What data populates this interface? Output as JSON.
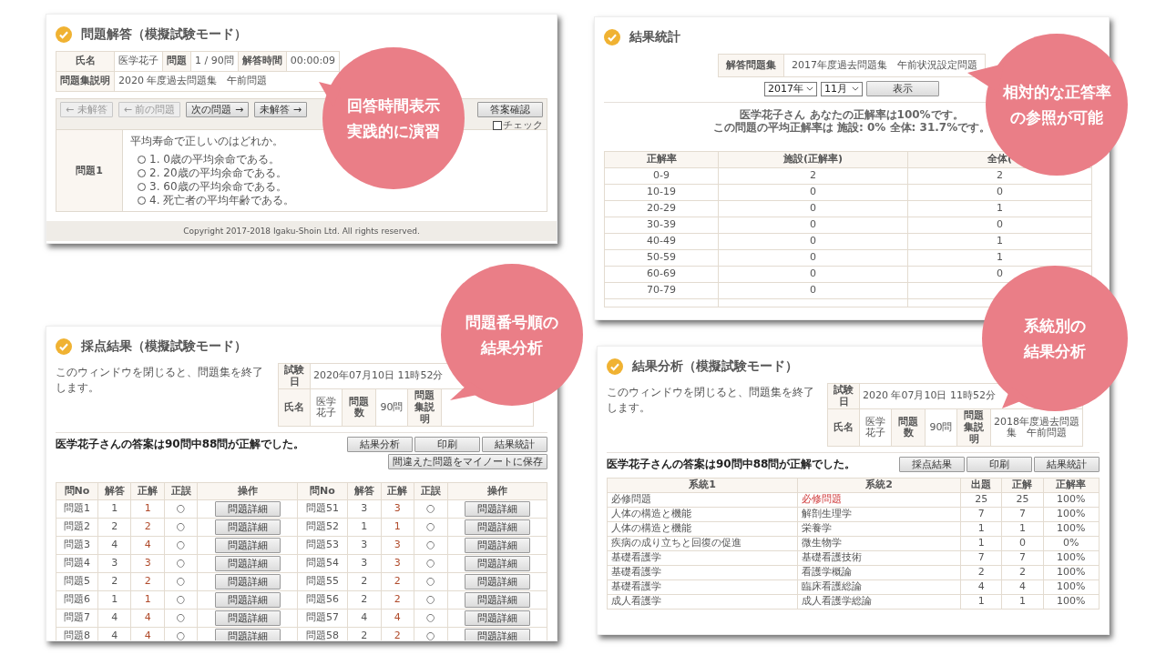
{
  "answer_panel": {
    "title": "問題解答（模擬試験モード）",
    "info": [
      {
        "label": "氏名",
        "value": "医学花子"
      },
      {
        "label": "問題",
        "value": "1 / 90問"
      },
      {
        "label": "解答時間",
        "value": "00:00:09"
      }
    ],
    "description": {
      "label": "問題集説明",
      "value": "2020 年度過去問題集　午前問題"
    },
    "nav_buttons": [
      {
        "label": "← 未解答",
        "disabled": true
      },
      {
        "label": "← 前の問題",
        "disabled": true
      },
      {
        "label": "次の問題 →",
        "disabled": false
      },
      {
        "label": "未解答 →",
        "disabled": false
      }
    ],
    "confirm_button": "答案確認",
    "check": {
      "label": "チェック",
      "checked": false
    },
    "question": {
      "label": "問題1",
      "text": "平均寿命で正しいのはどれか。",
      "options": [
        {
          "label": "1. 0歳の平均余命である。",
          "selected": false
        },
        {
          "label": "2. 20歳の平均余命である。",
          "selected": false
        },
        {
          "label": "3. 60歳の平均余命である。",
          "selected": false
        },
        {
          "label": "4. 死亡者の平均年齢である。",
          "selected": false
        }
      ]
    },
    "copyright": "Copyright 2017-2018 Igaku-Shoin Ltd. All rights reserved."
  },
  "stats_panel": {
    "title": "結果統計",
    "set": {
      "label": "解答問題集",
      "value": "2017年度過去問題集　午前状況設定問題"
    },
    "year_select": "2017年",
    "month_select": "11月",
    "show_button": "表示",
    "message": [
      "医学花子さん あなたの正解率は100%です。",
      "この問題の平均正解率は 施設: 0% 全体: 31.7%です。"
    ],
    "table": {
      "columns": [
        "正解率",
        "施設(正解率)",
        "全体("
      ],
      "rows": [
        {
          "cells": [
            "0-9",
            "2",
            "2"
          ]
        },
        {
          "cells": [
            "10-19",
            "0",
            "0"
          ]
        },
        {
          "cells": [
            "20-29",
            "0",
            "1"
          ]
        },
        {
          "cells": [
            "30-39",
            "0",
            "0"
          ]
        },
        {
          "cells": [
            "40-49",
            "0",
            "1"
          ]
        },
        {
          "cells": [
            "50-59",
            "0",
            "1"
          ]
        },
        {
          "cells": [
            "60-69",
            "0",
            "0"
          ]
        },
        {
          "cells": [
            "70-79",
            "0"
          ]
        }
      ]
    }
  },
  "scoring_panel": {
    "title": "採点結果（模擬試験モード）",
    "note": "このウィンドウを閉じると、問題集を終了します。",
    "exam_date": {
      "label": "試験日",
      "value": "2020年07月10日 11時52分"
    },
    "info": [
      {
        "label": "氏名",
        "value": "医学花子"
      },
      {
        "label": "問題数",
        "value": "90問"
      },
      {
        "label": "問題集説明"
      }
    ],
    "summary": "医学花子さんの答案は90問中88問が正解でした。",
    "buttons": [
      "結果分析",
      "印刷",
      "結果統計",
      "間違えた問題をマイノートに保存"
    ],
    "table": {
      "columns": [
        "問No",
        "解答",
        "正解",
        "正誤",
        "操作",
        "問No",
        "解答",
        "正解",
        "正誤",
        "操作"
      ],
      "rows": [
        {
          "left": {
            "no": "問題1",
            "answer": "1",
            "correct": "1",
            "mark": "○",
            "button": "問題詳細"
          },
          "right": {
            "no": "問題51",
            "answer": "3",
            "correct": "3",
            "mark": "○",
            "button": "問題詳細"
          }
        },
        {
          "left": {
            "no": "問題2",
            "answer": "2",
            "correct": "2",
            "mark": "○",
            "button": "問題詳細"
          },
          "right": {
            "no": "問題52",
            "answer": "1",
            "correct": "1",
            "mark": "○",
            "button": "問題詳細"
          }
        },
        {
          "left": {
            "no": "問題3",
            "answer": "4",
            "correct": "4",
            "mark": "○",
            "button": "問題詳細"
          },
          "right": {
            "no": "問題53",
            "answer": "3",
            "correct": "3",
            "mark": "○",
            "button": "問題詳細"
          }
        },
        {
          "left": {
            "no": "問題4",
            "answer": "3",
            "correct": "3",
            "mark": "○",
            "button": "問題詳細"
          },
          "right": {
            "no": "問題54",
            "answer": "3",
            "correct": "3",
            "mark": "○",
            "button": "問題詳細"
          }
        },
        {
          "left": {
            "no": "問題5",
            "answer": "2",
            "correct": "2",
            "mark": "○",
            "button": "問題詳細"
          },
          "right": {
            "no": "問題55",
            "answer": "2",
            "correct": "2",
            "mark": "○",
            "button": "問題詳細"
          }
        },
        {
          "left": {
            "no": "問題6",
            "answer": "1",
            "correct": "1",
            "mark": "○",
            "button": "問題詳細"
          },
          "right": {
            "no": "問題56",
            "answer": "2",
            "correct": "2",
            "mark": "○",
            "button": "問題詳細"
          }
        },
        {
          "left": {
            "no": "問題7",
            "answer": "4",
            "correct": "4",
            "mark": "○",
            "button": "問題詳細"
          },
          "right": {
            "no": "問題57",
            "answer": "4",
            "correct": "4",
            "mark": "○",
            "button": "問題詳細"
          }
        },
        {
          "left": {
            "no": "問題8",
            "answer": "4",
            "correct": "4",
            "mark": "○",
            "button": "問題詳細"
          },
          "right": {
            "no": "問題58",
            "answer": "2",
            "correct": "2",
            "mark": "○",
            "button": "問題詳細"
          }
        }
      ]
    }
  },
  "analysis_panel": {
    "title": "結果分析（模擬試験モード）",
    "note": "このウィンドウを閉じると、問題集を終了します。",
    "exam_date": {
      "label": "試験日",
      "value": "2020 年07月10日 11時52分"
    },
    "info": [
      {
        "label": "氏名",
        "value": "医学花子"
      },
      {
        "label": "問題数",
        "value": "90問"
      },
      {
        "label": "問題集説明",
        "value": "2018年度過去問題集　午前問題"
      }
    ],
    "summary": "医学花子さんの答案は90問中88問が正解でした。",
    "buttons": [
      "採点結果",
      "印刷",
      "結果統計"
    ],
    "table": {
      "columns": [
        "系統1",
        "系統2",
        "出題",
        "正解",
        "正解率"
      ],
      "rows": [
        {
          "cells": [
            "必修問題",
            "必修問題",
            "25",
            "25",
            "100%"
          ],
          "highlighted": true
        },
        {
          "cells": [
            "人体の構造と機能",
            "解剖生理学",
            "7",
            "7",
            "100%"
          ],
          "highlighted": false
        },
        {
          "cells": [
            "人体の構造と機能",
            "栄養学",
            "1",
            "1",
            "100%"
          ],
          "highlighted": false
        },
        {
          "cells": [
            "疾病の成り立ちと回復の促進",
            "微生物学",
            "1",
            "0",
            "0%"
          ],
          "highlighted": false
        },
        {
          "cells": [
            "基礎看護学",
            "基礎看護技術",
            "7",
            "7",
            "100%"
          ],
          "highlighted": false
        },
        {
          "cells": [
            "基礎看護学",
            "看護学概論",
            "2",
            "2",
            "100%"
          ],
          "highlighted": false
        },
        {
          "cells": [
            "基礎看護学",
            "臨床看護総論",
            "4",
            "4",
            "100%"
          ],
          "highlighted": false
        },
        {
          "cells": [
            "成人看護学",
            "成人看護学総論",
            "1",
            "1",
            "100%"
          ],
          "highlighted": false
        }
      ]
    }
  },
  "callouts": [
    {
      "lines": [
        "回答時間表示",
        "実践的に演習"
      ]
    },
    {
      "lines": [
        "相対的な正答率",
        "の参照が可能"
      ]
    },
    {
      "lines": [
        "問題番号順の",
        "結果分析"
      ]
    },
    {
      "lines": [
        "系統別の",
        "結果分析"
      ]
    }
  ]
}
